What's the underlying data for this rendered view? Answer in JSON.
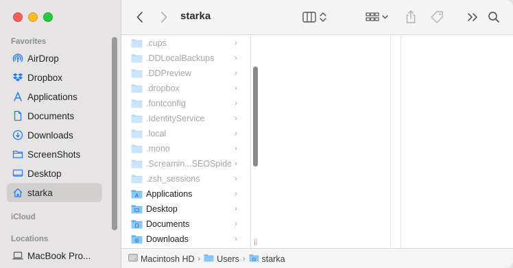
{
  "window": {
    "title": "starka"
  },
  "sidebar": {
    "favorites_heading": "Favorites",
    "items": [
      {
        "label": "AirDrop",
        "icon": "airdrop-icon"
      },
      {
        "label": "Dropbox",
        "icon": "dropbox-icon"
      },
      {
        "label": "Applications",
        "icon": "applications-icon"
      },
      {
        "label": "Documents",
        "icon": "document-icon"
      },
      {
        "label": "Downloads",
        "icon": "download-icon"
      },
      {
        "label": "ScreenShots",
        "icon": "folder-icon"
      },
      {
        "label": "Desktop",
        "icon": "desktop-icon"
      },
      {
        "label": "starka",
        "icon": "home-icon",
        "selected": true
      }
    ],
    "icloud_heading": "iCloud",
    "locations_heading": "Locations",
    "locations": [
      {
        "label": "MacBook Pro...",
        "icon": "laptop-icon"
      }
    ]
  },
  "toolbar": {
    "back": "back-icon",
    "forward": "forward-icon",
    "view": "column-view-icon",
    "group": "group-icon",
    "share": "share-icon",
    "tags": "tag-icon",
    "more": "more-icon",
    "search": "search-icon"
  },
  "files": [
    {
      "name": ".cups",
      "hidden": true
    },
    {
      "name": ".DDLocalBackups",
      "hidden": true
    },
    {
      "name": ".DDPreview",
      "hidden": true
    },
    {
      "name": ".dropbox",
      "hidden": true
    },
    {
      "name": ".fontconfig",
      "hidden": true
    },
    {
      "name": ".IdentityService",
      "hidden": true
    },
    {
      "name": ".local",
      "hidden": true
    },
    {
      "name": ".mono",
      "hidden": true
    },
    {
      "name": ".Screamin...SEOSpider",
      "hidden": true
    },
    {
      "name": ".zsh_sessions",
      "hidden": true
    },
    {
      "name": "Applications",
      "hidden": false,
      "badge": "applications"
    },
    {
      "name": "Desktop",
      "hidden": false,
      "badge": "desktop"
    },
    {
      "name": "Documents",
      "hidden": false,
      "badge": "documents"
    },
    {
      "name": "Downloads",
      "hidden": false,
      "badge": "downloads"
    }
  ],
  "pathbar": {
    "crumbs": [
      "Macintosh HD",
      "Users",
      "starka"
    ]
  },
  "colors": {
    "accent": "#1d7ff0",
    "folder": "#78b9ef"
  }
}
